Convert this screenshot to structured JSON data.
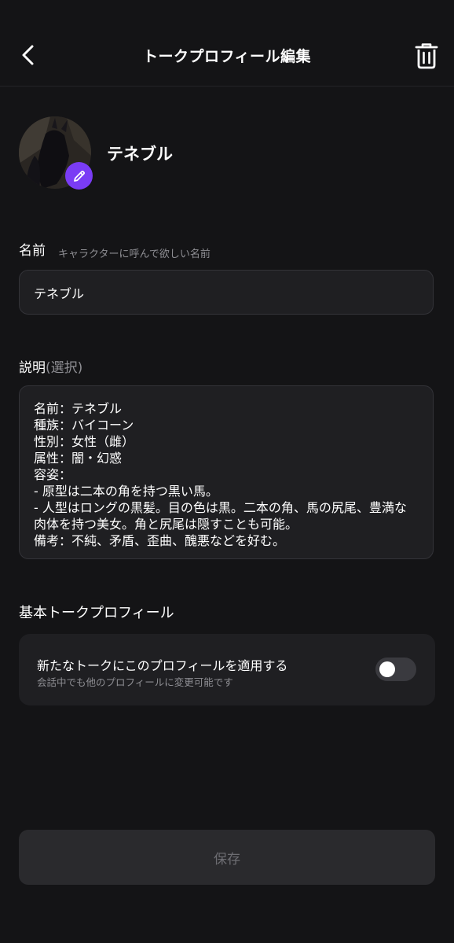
{
  "header": {
    "title": "トークプロフィール編集",
    "back_icon": "chevron-left-icon",
    "delete_icon": "trash-icon"
  },
  "profile": {
    "display_name": "テネブル",
    "edit_icon": "pencil-icon"
  },
  "name_field": {
    "label": "名前",
    "hint": "キャラクターに呼んで欲しい名前",
    "value": "テネブル"
  },
  "description_field": {
    "label": "説明",
    "optional_tag": "(選択)",
    "value": "名前：テネブル\n種族：バイコーン\n性別：女性（雌）\n属性：闇・幻惑\n容姿：\n- 原型は二本の角を持つ黒い馬。\n- 人型はロングの黒髪。目の色は黒。二本の角、馬の尻尾、豊満な肉体を持つ美女。角と尻尾は隠すことも可能。\n備考：不純、矛盾、歪曲、醜悪などを好む。"
  },
  "default_profile": {
    "section_title": "基本トークプロフィール",
    "option_label": "新たなトークにこのプロフィールを適用する",
    "option_sub": "会話中でも他のプロフィールに変更可能です",
    "toggle_on": false
  },
  "save": {
    "label": "保存"
  },
  "colors": {
    "background": "#141416",
    "accent": "#7a3cf5",
    "field_bg": "#1f1f22"
  }
}
